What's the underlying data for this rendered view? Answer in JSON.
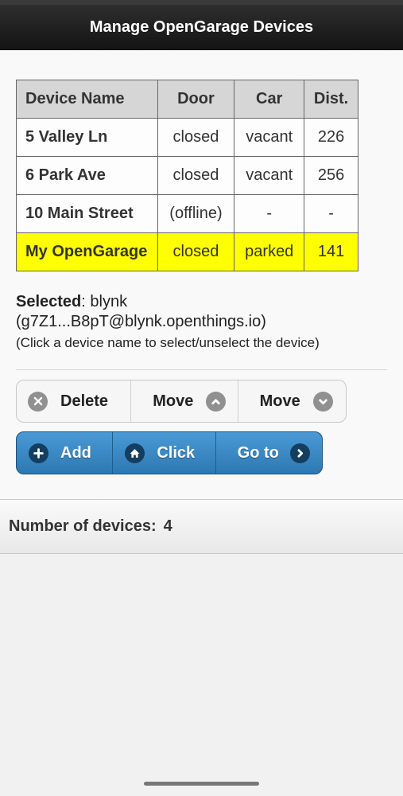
{
  "header": {
    "title": "Manage OpenGarage Devices"
  },
  "table": {
    "columns": [
      "Device Name",
      "Door",
      "Car",
      "Dist."
    ],
    "rows": [
      {
        "name": "5 Valley Ln",
        "door": "closed",
        "car": "vacant",
        "dist": "226"
      },
      {
        "name": "6 Park Ave",
        "door": "closed",
        "car": "vacant",
        "dist": "256"
      },
      {
        "name": "10 Main Street",
        "door": "(offline)",
        "car": "-",
        "dist": "-"
      },
      {
        "name": "My OpenGarage",
        "door": "closed",
        "car": "parked",
        "dist": "141"
      }
    ],
    "highlight_color": "#ffff00"
  },
  "selected": {
    "label": "Selected",
    "value": ": blynk",
    "token": "(g7Z1...B8pT@blynk.openthings.io)",
    "hint": "(Click a device name to select/unselect the device)"
  },
  "actions": {
    "delete_label": "Delete",
    "move_up_label": "Move",
    "move_down_label": "Move",
    "add_label": "Add",
    "click_label": "Click",
    "goto_label": "Go to"
  },
  "footer": {
    "label": "Number of devices:",
    "count": "4"
  },
  "colors": {
    "accent_blue": "#3584c4",
    "header_bg": "#1e1e1e"
  }
}
